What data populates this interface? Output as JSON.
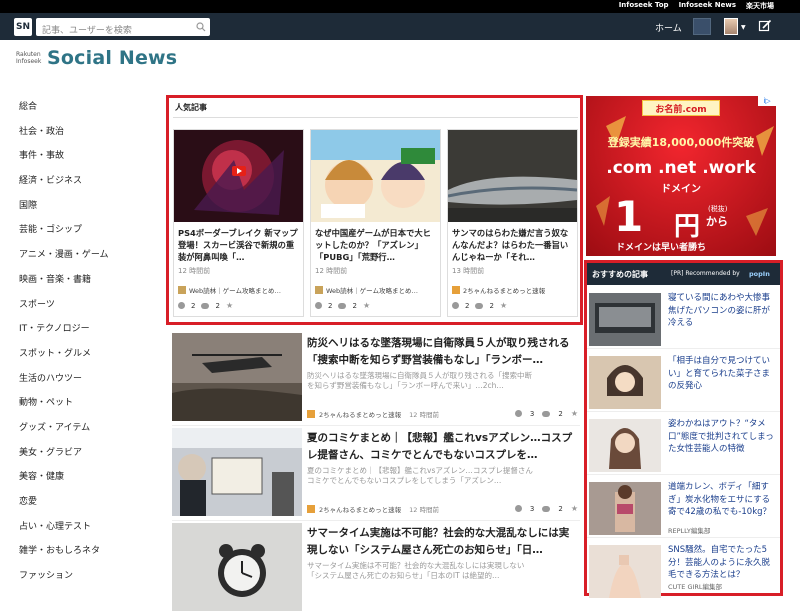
{
  "top_links": [
    "Infoseek Top",
    "Infoseek News",
    "楽天市場"
  ],
  "header": {
    "logo": "SN",
    "search_placeholder": "記事、ユーザーを検索",
    "home": "ホーム"
  },
  "brand": {
    "small": "Rakuten Infoseek",
    "main": "Social News"
  },
  "sidebar": {
    "items": [
      "総合",
      "社会・政治",
      "事件・事故",
      "経済・ビジネス",
      "国際",
      "芸能・ゴシップ",
      "アニメ・漫画・ゲーム",
      "映画・音楽・書籍",
      "スポーツ",
      "IT・テクノロジー",
      "スポット・グルメ",
      "生活のハウツー",
      "動物・ペット",
      "グッズ・アイテム",
      "美女・グラビア",
      "美容・健康",
      "恋愛",
      "占い・心理テスト",
      "雑学・おもしろネタ",
      "ファッション"
    ]
  },
  "popular": {
    "title": "人気記事",
    "cards": [
      {
        "title": "PS4ボーダーブレイク 新マップ登場！スカービ渓谷で新規の重装が阿鼻叫喚「…",
        "time": "12 時間前",
        "source": "Web読林｜ゲーム攻略まとめ…",
        "c1": "2",
        "c2": "2"
      },
      {
        "title": "なぜ中国産ゲームが日本で大ヒットしたのか？「アズレン」「PUBG」「荒野行…",
        "time": "12 時間前",
        "source": "Web読林｜ゲーム攻略まとめ…",
        "c1": "2",
        "c2": "2"
      },
      {
        "title": "サンマのはらわた嫌だ言う奴なんなんだよ？はらわた一番旨いんじゃねーか「それ…",
        "time": "13 時間前",
        "source": "2ちゃんねるまとめっと速報",
        "c1": "2",
        "c2": "2"
      }
    ]
  },
  "list": [
    {
      "title": "防災ヘリはるな墜落現場に自衛隊員５人が取り残される「捜索中断を知らず野営装備もなし」「ランボー…",
      "summary": "防災ヘリはるな墜落現場に自衛隊員５人が取り残される「捜索中断を知らず野営装備もなし」「ランボー呼んで来い」…2ch…",
      "source": "2ちゃんねるまとめっと速報",
      "time": "12 時間前",
      "c1": "3",
      "c2": "2"
    },
    {
      "title": "夏のコミケまとめ｜【悲報】艦これvsアズレン…コスプレ提督さん、コミケでとんでもないコスプレを…",
      "summary": "夏のコミケまとめ｜【悲報】艦これvsアズレン…コスプレ提督さんコミケでとんでもないコスプレをしてしまう「アズレン…",
      "source": "2ちゃんねるまとめっと速報",
      "time": "12 時間前",
      "c1": "3",
      "c2": "2"
    },
    {
      "title": "サマータイム実施は不可能？社会的な大混乱なしには実現しない「システム屋さん死亡のお知らせ」「日…",
      "summary": "サマータイム実施は不可能？社会的な大混乱なしには実現しない「システム屋さん死亡のお知らせ」「日本のIT は絶望的…",
      "source": "",
      "time": "",
      "c1": "",
      "c2": ""
    }
  ],
  "ad": {
    "mark": "i▷",
    "logo": "お名前.com",
    "line1": "登録実績18,000,000件突破",
    "line2": ".com .net .work",
    "line3": "ドメイン",
    "big": "1",
    "yen": "円",
    "tax": "(税抜)",
    "kara": "から",
    "foot": "ドメインは早い者勝ち"
  },
  "reco": {
    "title": "おすすめの記事",
    "pr": "[PR] Recommended by",
    "popin": "popIn",
    "items": [
      {
        "title": "寝ている間にあわや大惨事　焦げたパソコンの姿に肝が冷える",
        "source": ""
      },
      {
        "title": "「相手は自分で見つけていい」と育てられた菜子さまの反発心",
        "source": ""
      },
      {
        "title": "姿わかねはアウト？“タメ口”態度で批判されてしまった女性芸能人の特徴",
        "source": ""
      },
      {
        "title": "道端カレン、ボディ「細すぎ」炭水化物をエサにする寄で42歳の私でも-10kg？",
        "source": "REPLLY編集部"
      },
      {
        "title": "SNS騒然。自宅でたった5分！芸能人のように永久脱毛できる方法とは？",
        "source": "CUTE GIRL編集部"
      }
    ]
  },
  "colors": {
    "header_bg": "#1e2b38",
    "brand": "#2f7486",
    "highlight_border": "#d81e27",
    "link": "#1a3e8c"
  }
}
